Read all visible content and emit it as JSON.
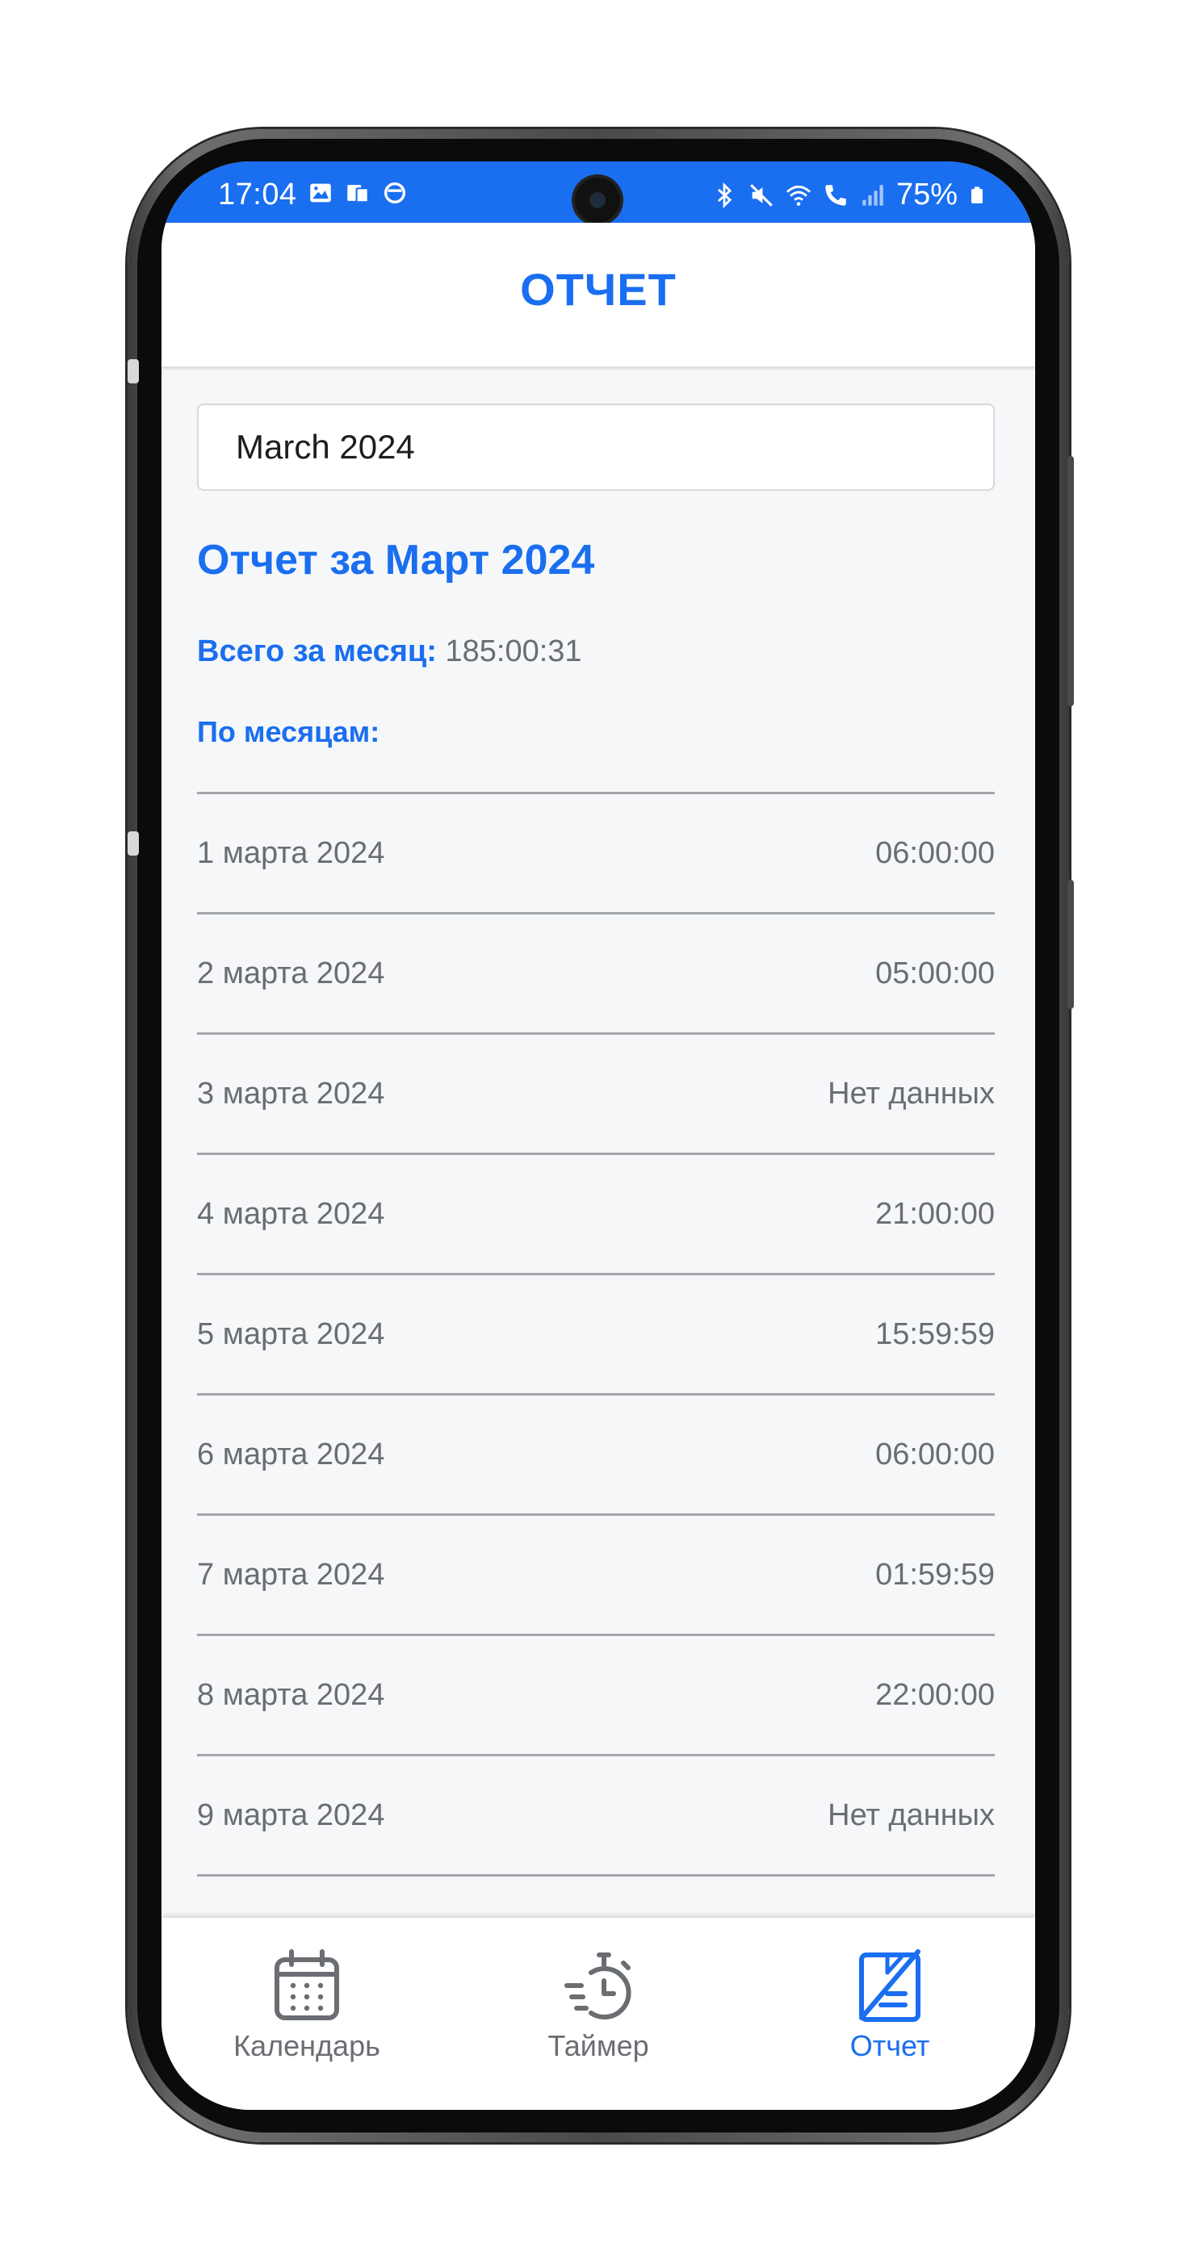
{
  "status_bar": {
    "time": "17:04",
    "battery": "75%",
    "left_icons": [
      "image-icon",
      "cast-icon",
      "circle-icon"
    ],
    "right_icons": [
      "bluetooth-icon",
      "mute-icon",
      "wifi-icon",
      "call-icon",
      "signal-icon",
      "battery-icon"
    ]
  },
  "header": {
    "title": "ОТЧЕТ"
  },
  "month_selector": {
    "value": "March 2024"
  },
  "report": {
    "title": "Отчет за Март 2024",
    "total_label": "Всего за месяц:",
    "total_value": "185:00:31",
    "by_months_label": "По месяцам:",
    "rows": [
      {
        "date": "1 марта 2024",
        "value": "06:00:00"
      },
      {
        "date": "2 марта 2024",
        "value": "05:00:00"
      },
      {
        "date": "3 марта 2024",
        "value": "Нет данных"
      },
      {
        "date": "4 марта 2024",
        "value": "21:00:00"
      },
      {
        "date": "5 марта 2024",
        "value": "15:59:59"
      },
      {
        "date": "6 марта 2024",
        "value": "06:00:00"
      },
      {
        "date": "7 марта 2024",
        "value": "01:59:59"
      },
      {
        "date": "8 марта 2024",
        "value": "22:00:00"
      },
      {
        "date": "9 марта 2024",
        "value": "Нет данных"
      }
    ]
  },
  "tabbar": {
    "items": [
      {
        "label": "Календарь",
        "icon": "calendar-icon",
        "active": false
      },
      {
        "label": "Таймер",
        "icon": "stopwatch-icon",
        "active": false
      },
      {
        "label": "Отчет",
        "icon": "report-icon",
        "active": true
      }
    ]
  },
  "colors": {
    "accent": "#1a6ef0",
    "text_muted": "#6a6d72",
    "background": "#f6f7f9"
  }
}
